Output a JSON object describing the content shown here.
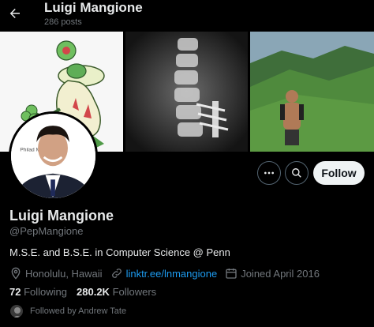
{
  "header": {
    "name": "Luigi Mangione",
    "posts": "286 posts"
  },
  "profile": {
    "name": "Luigi Mangione",
    "handle": "@PepMangione",
    "bio": "M.S.E. and B.S.E. in Computer Science @ Penn",
    "location": "Honolulu, Hawaii",
    "link": "linktr.ee/lnmangione",
    "joined": "Joined April 2016",
    "following_count": "72",
    "following_label": "Following",
    "followers_count": "280.2K",
    "followers_label": "Followers",
    "followed_by": "Followed by Andrew Tate",
    "avatar_backdrop_text": "Philad Muse"
  },
  "actions": {
    "follow_label": "Follow"
  },
  "icons": {
    "back": "arrow-left-icon",
    "more": "more-horizontal-icon",
    "search": "search-icon",
    "location": "location-pin-icon",
    "link": "link-icon",
    "joined": "calendar-icon"
  },
  "colors": {
    "background": "#000000",
    "text": "#e7e9ea",
    "secondary": "#71767b",
    "link": "#1d9bf0",
    "follow_bg": "#eff3f4"
  }
}
